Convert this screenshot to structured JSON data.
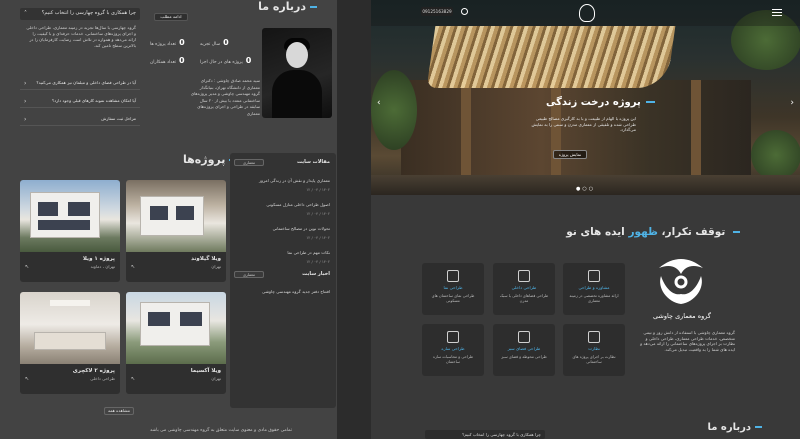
{
  "left": {
    "faq": {
      "open_question": "چرا همکاری با گروه چهارسی را انتخاب کنیم؟",
      "open_answer": "گروه چهارسی با سال‌ها تجربه در زمینه معماری، طراحی داخلی و اجرای پروژه‌های ساختمانی، خدمات حرفه‌ای و با کیفیت را ارائه می‌دهد و همواره در تلاش است رضایت کارفرمایان را در بالاترین سطح تامین کند.",
      "q2": "آیا در طراحی فضای داخلی و مبلمان نیز همکاری می‌کنید؟",
      "q3": "آیا امکان مشاهده نمونه کارهای قبلی وجود دارد؟",
      "q4": "مراحل ثبت سفارش"
    },
    "about": {
      "title": "درباره ما",
      "more_button": "ادامه مطلب",
      "stats": [
        {
          "value": "0",
          "label": "سال تجربه"
        },
        {
          "value": "0",
          "label": "تعداد پروژه ها"
        },
        {
          "value": "0",
          "label": "پروژه های در حال اجرا"
        },
        {
          "value": "0",
          "label": "تعداد همکاران"
        }
      ],
      "person": "سید محمد صادق چاوشی",
      "bio": "سید محمد صادق چاوشی : دکترای معماری از دانشگاه تهران، بنیانگذار گروه مهندسی چاوشی و مدیر پروژه‌های ساختمانی متعدد با بیش از ۲۰ سال سابقه در طراحی و اجرای پروژه‌های معماری"
    },
    "projects": {
      "title": "پروژه‌ها",
      "items": [
        {
          "name": "ویلا گیلاوند",
          "sub": "تهران"
        },
        {
          "name": "پروژه ۱ ویلا",
          "sub": "تهران ، دماوند"
        },
        {
          "name": "ویلا آکسیما",
          "sub": "تهران"
        },
        {
          "name": "پروژه ۲ لاکچری",
          "sub": "طراحی داخلی"
        }
      ],
      "all_button": "مشاهده همه"
    },
    "blog": {
      "title": "مقالات سایت",
      "tag": "معماری",
      "items": [
        {
          "title": "معماری پایدار و نقش آن در زندگی امروز",
          "date": "۱۴۰۲ / ۰۴ / ۱۲"
        },
        {
          "title": "اصول طراحی داخلی منازل مسکونی",
          "date": "۱۴۰۲ / ۰۴ / ۱۲"
        },
        {
          "title": "تحولات نوین در مصالح ساختمانی",
          "date": "۱۴۰۲ / ۰۴ / ۱۲"
        },
        {
          "title": "نکات مهم در طراحی نما",
          "date": "۱۴۰۲ / ۰۴ / ۱۲"
        }
      ],
      "latest_title": "اخبار سایت",
      "latest_item": "افتتاح دفتر جدید گروه مهندسی چاوشی"
    },
    "copyright": "تمامی حقوق مادی و معنوی سایت متعلق به گروه مهندسی چاوشی می باشد"
  },
  "right": {
    "nav": {
      "phone": "09125163829"
    },
    "hero": {
      "title": "پروژه درخت زندگی",
      "description": "این پروژه با الهام از طبیعت و با به کارگیری مصالح طبیعی طراحی شده و تلفیقی از معماری مدرن و سنتی را به نمایش می‌گذارد.",
      "button": "نمایش پروژه"
    },
    "slogan_pre": "توقف تکرار، ",
    "slogan_accent": "ظهور",
    "slogan_post": " ایده های نو",
    "brand": {
      "name": "گروه معماری چاوشی",
      "description": "گروه معماری چاوشی با استفاده از دانش روز و تیمی متخصص، خدمات طراحی معماری، طراحی داخلی و نظارت بر اجرای پروژه‌های ساختمانی را ارائه می‌دهد و ایده های شما را به واقعیت تبدیل می‌کند."
    },
    "services": [
      {
        "name": "مشاوره و طراحی",
        "desc": "ارائه مشاوره تخصصی در زمینه معماری"
      },
      {
        "name": "طراحی داخلی",
        "desc": "طراحی فضاهای داخلی با سبک مدرن"
      },
      {
        "name": "طراحی نما",
        "desc": "طراحی نمای ساختمان های مسکونی"
      },
      {
        "name": "نظارت",
        "desc": "نظارت بر اجرای پروژه های ساختمانی"
      },
      {
        "name": "طراحی فضای سبز",
        "desc": "طراحی محوطه و فضای سبز"
      },
      {
        "name": "طراحی سازه",
        "desc": "طراحی و محاسبات سازه ساختمان"
      }
    ],
    "faq_head": "چرا همکاری با گروه چهارسی را انتخاب کنیم؟",
    "about_title": "درباره ما"
  }
}
